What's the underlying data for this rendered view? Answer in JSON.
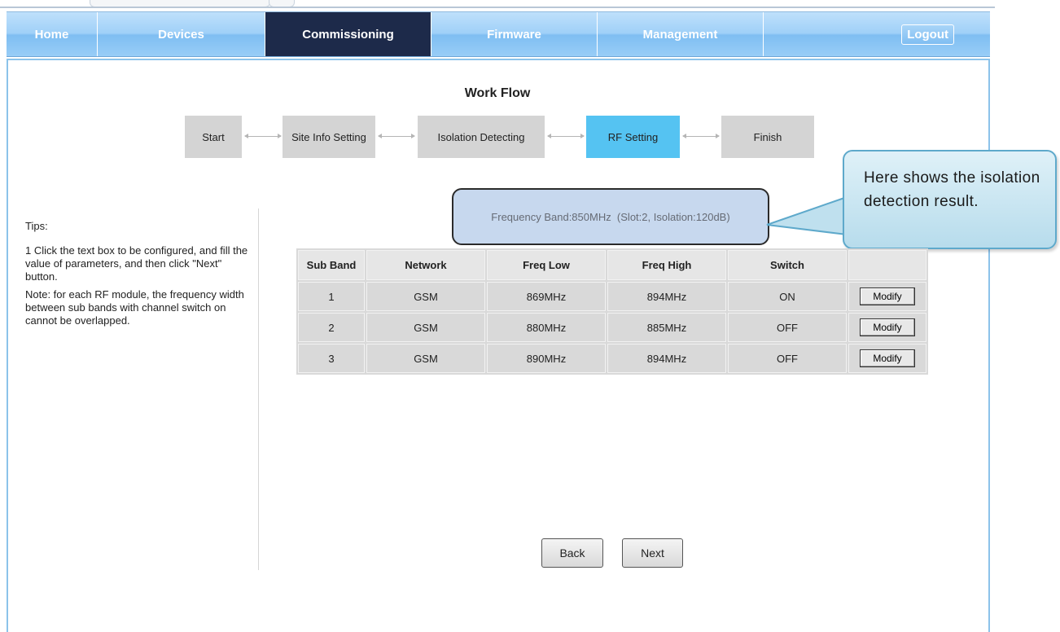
{
  "nav": {
    "items": [
      "Home",
      "Devices",
      "Commissioning",
      "Firmware",
      "Management"
    ],
    "active": "Commissioning",
    "logout_label": "Logout"
  },
  "workflow": {
    "title": "Work Flow",
    "steps": [
      "Start",
      "Site Info Setting",
      "Isolation Detecting",
      "RF Setting",
      "Finish"
    ],
    "active_step": "RF Setting"
  },
  "tips": {
    "title": "Tips:",
    "line1": "1 Click the text box to be configured, and fill the value of parameters, and then click \"Next\" button.",
    "note": "Note: for each RF module, the frequency width between sub bands with channel switch on cannot be overlapped."
  },
  "frequency_band": "Frequency Band:850MHz  (Slot:2, Isolation:120dB)",
  "callout": {
    "text": "Here shows the isolation detection result."
  },
  "table": {
    "headers": [
      "Sub Band",
      "Network",
      "Freq Low",
      "Freq High",
      "Switch",
      ""
    ],
    "rows": [
      {
        "sub_band": "1",
        "network": "GSM",
        "freq_low": "869MHz",
        "freq_high": "894MHz",
        "switch": "ON",
        "action": "Modify"
      },
      {
        "sub_band": "2",
        "network": "GSM",
        "freq_low": "880MHz",
        "freq_high": "885MHz",
        "switch": "OFF",
        "action": "Modify"
      },
      {
        "sub_band": "3",
        "network": "GSM",
        "freq_low": "890MHz",
        "freq_high": "894MHz",
        "switch": "OFF",
        "action": "Modify"
      }
    ]
  },
  "buttons": {
    "back": "Back",
    "next": "Next"
  },
  "colors": {
    "nav_active": "#1d2a4a",
    "step_active": "#55c3f2",
    "freq_box": "#c7d8ee"
  }
}
